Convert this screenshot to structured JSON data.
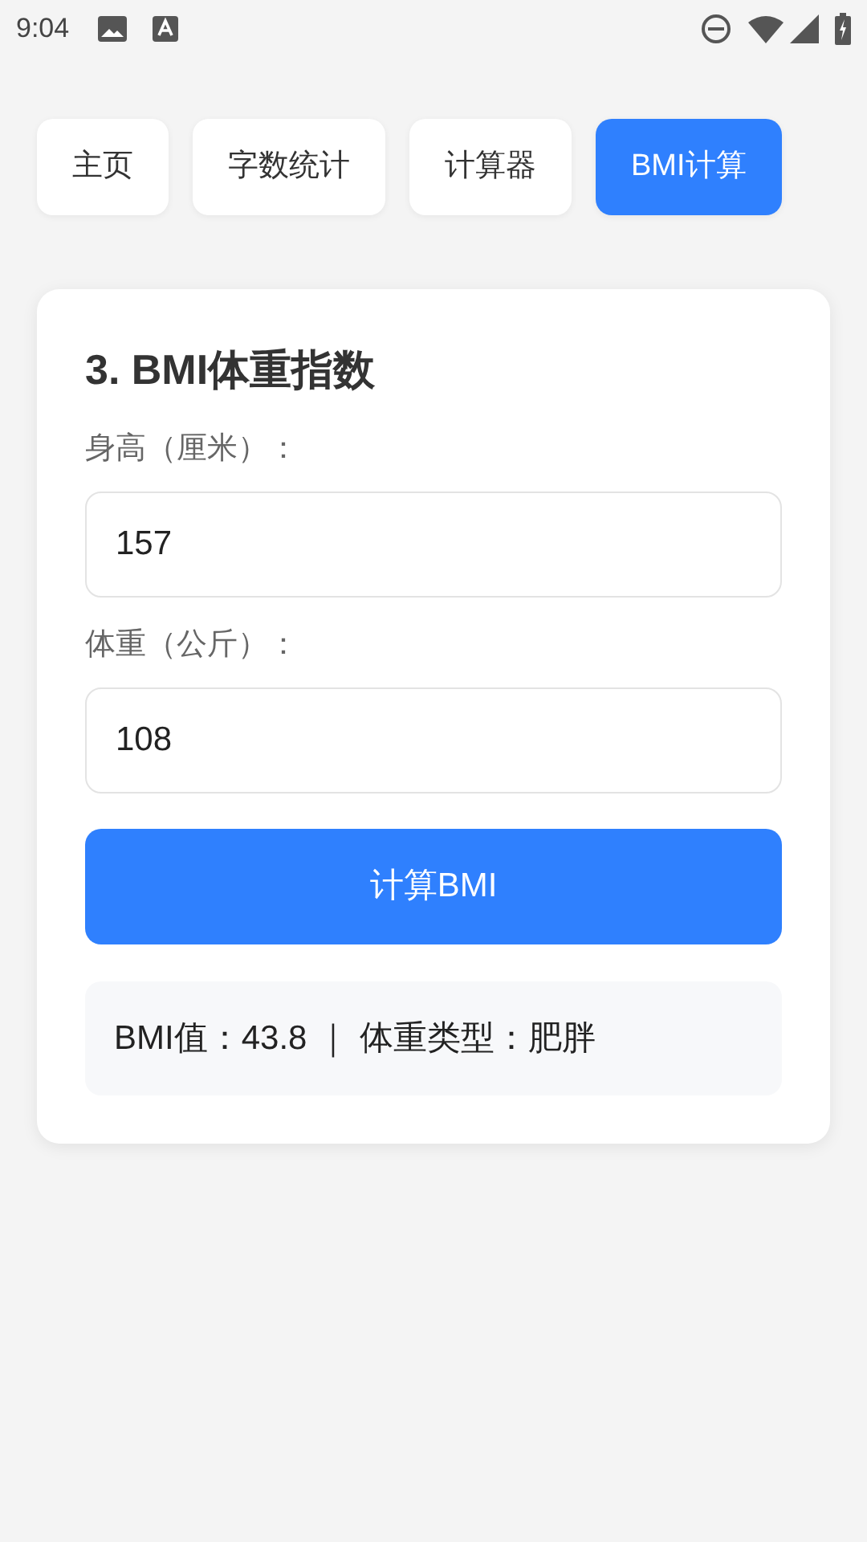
{
  "status_bar": {
    "time": "9:04"
  },
  "tabs": [
    {
      "label": "主页",
      "selected": false
    },
    {
      "label": "字数统计",
      "selected": false
    },
    {
      "label": "计算器",
      "selected": false
    },
    {
      "label": "BMI计算",
      "selected": true
    }
  ],
  "card": {
    "title": "3. BMI体重指数",
    "fields": [
      {
        "label": "身高（厘米）：",
        "value": "157"
      },
      {
        "label": "体重（公斤）：",
        "value": "108"
      }
    ],
    "button": "计算BMI",
    "result": "BMI值：43.8 ｜ 体重类型：肥胖"
  }
}
